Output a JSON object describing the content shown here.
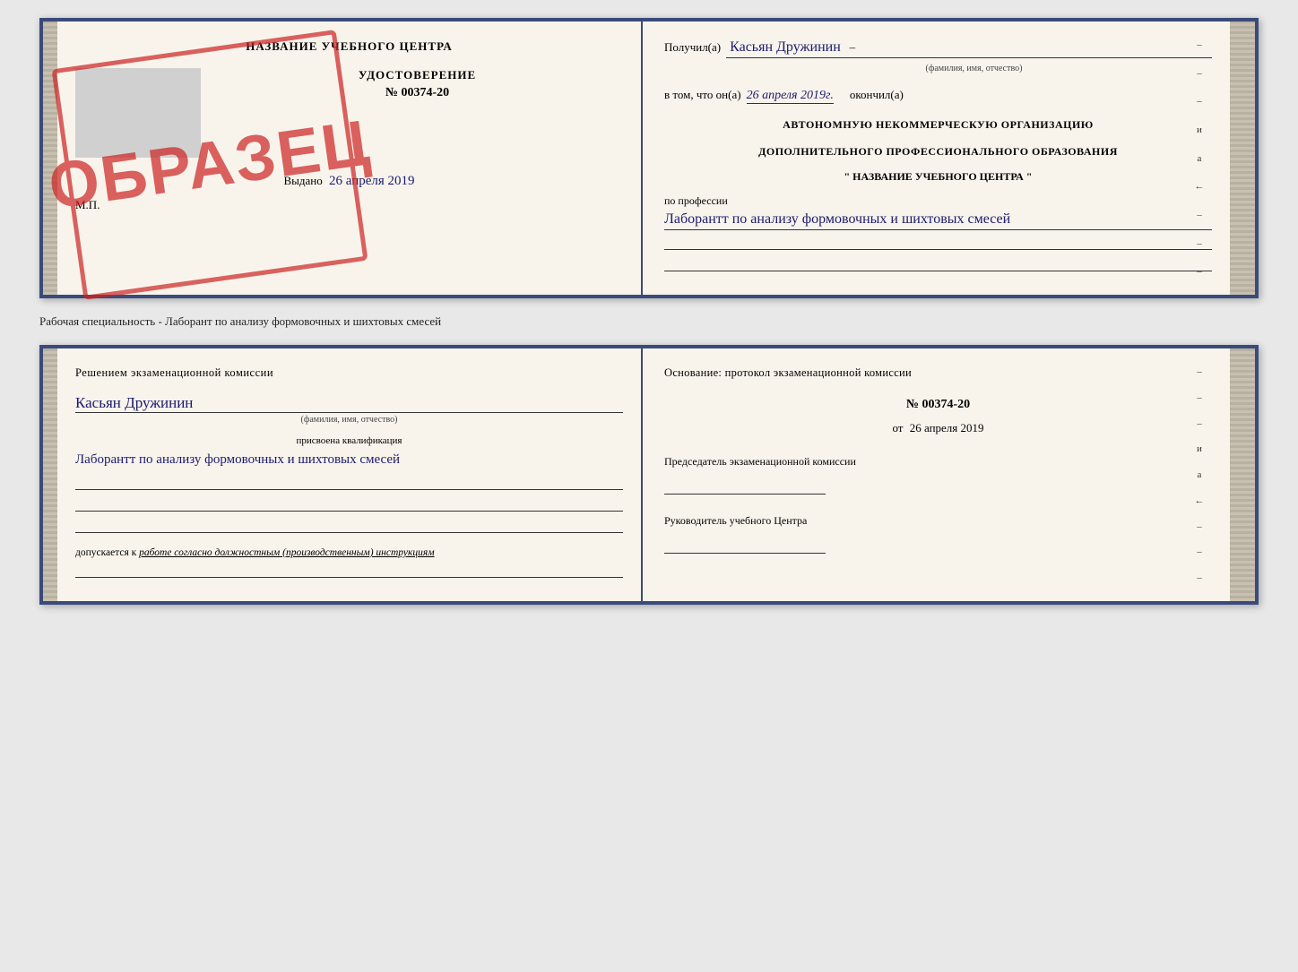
{
  "top_book": {
    "left": {
      "title": "НАЗВАНИЕ УЧЕБНОГО ЦЕНТРА",
      "cert_label": "УДОСТОВЕРЕНИЕ",
      "cert_number": "№ 00374-20",
      "issued_label": "Выдано",
      "issued_date": "26 апреля 2019",
      "mp_label": "М.П.",
      "stamp_text": "ОБРАЗЕЦ"
    },
    "right": {
      "received_label": "Получил(а)",
      "received_name": "Касьян Дружинин",
      "name_sub": "(фамилия, имя, отчество)",
      "in_that_label": "в том, что он(а)",
      "date_value": "26 апреля 2019г.",
      "finished_label": "окончил(а)",
      "org_line1": "АВТОНОМНУЮ НЕКОММЕРЧЕСКУЮ ОРГАНИЗАЦИЮ",
      "org_line2": "ДОПОЛНИТЕЛЬНОГО ПРОФЕССИОНАЛЬНОГО ОБРАЗОВАНИЯ",
      "org_quote": "\"   НАЗВАНИЕ УЧЕБНОГО ЦЕНТРА   \"",
      "profession_label": "по профессии",
      "profession_handwritten": "Лаборантт по анализу формовочных и шихтовых смесей",
      "side_dashes": [
        "-",
        "-",
        "-",
        "и",
        "а",
        "←",
        "-",
        "-",
        "-"
      ]
    }
  },
  "middle_caption": "Рабочая специальность - Лаборант по анализу формовочных и шихтовых смесей",
  "bottom_book": {
    "left": {
      "decision_title": "Решением  экзаменационной  комиссии",
      "person_name": "Касьян  Дружинин",
      "name_sub": "(фамилия, имя, отчество)",
      "qualification_label": "присвоена квалификация",
      "qualification_handwritten": "Лаборантт по анализу формовочных и шихтовых смесей",
      "allowed_prefix": "допускается к",
      "allowed_italic": "работе согласно должностным (производственным) инструкциям"
    },
    "right": {
      "basis_title": "Основание: протокол экзаменационной  комиссии",
      "protocol_number": "№  00374-20",
      "date_label": "от",
      "date_value": "26 апреля 2019",
      "chairman_label": "Председатель экзаменационной комиссии",
      "director_label": "Руководитель учебного Центра",
      "side_dashes": [
        "-",
        "-",
        "-",
        "и",
        "а",
        "←",
        "-",
        "-",
        "-"
      ]
    }
  }
}
